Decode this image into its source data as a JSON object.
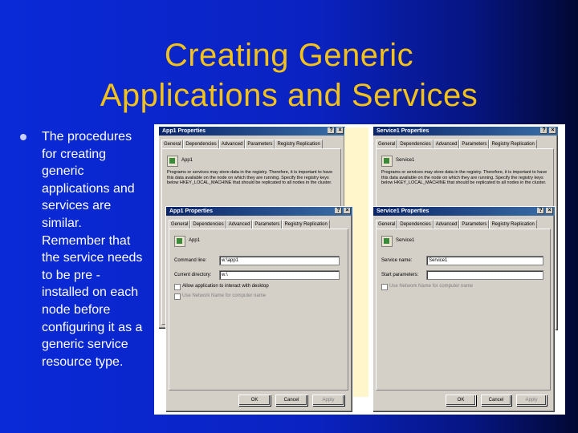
{
  "slide": {
    "title_line1": "Creating Generic",
    "title_line2": "Applications and Services",
    "bullet": "The procedures for creating generic applications and services are similar. Remember that the service needs to be pre -installed on each node before configuring it as a generic service resource type."
  },
  "app_back": {
    "title": "App1 Properties",
    "help": "?",
    "close": "×",
    "tabs": [
      "General",
      "Dependencies",
      "Advanced",
      "Parameters",
      "Registry Replication"
    ],
    "name": "App1",
    "desc": "Programs or services may store data in the registry. Therefore, it is important to have this data available on the node on which they are running. Specify the registry keys below HKEY_LOCAL_MACHINE that should be replicated to all nodes in the cluster."
  },
  "app_front": {
    "title": "App1 Properties",
    "help": "?",
    "close": "×",
    "tabs": [
      "General",
      "Dependencies",
      "Advanced",
      "Parameters",
      "Registry Replication"
    ],
    "name": "App1",
    "command_line_label": "Command line:",
    "command_line_value": "w:\\app1",
    "current_dir_label": "Current directory:",
    "current_dir_value": "w:\\",
    "allow_interact": "Allow application to interact with desktop",
    "use_network_name": "Use Network Name for computer name",
    "ok": "OK",
    "cancel": "Cancel",
    "apply": "Apply"
  },
  "svc_back": {
    "title": "Service1 Properties",
    "help": "?",
    "close": "×",
    "tabs": [
      "General",
      "Dependencies",
      "Advanced",
      "Parameters",
      "Registry Replication"
    ],
    "name": "Service1",
    "desc": "Programs or services may store data in the registry. Therefore, it is important to have this data available on the node on which they are running. Specify the registry keys below HKEY_LOCAL_MACHINE that should be replicated to all nodes in the cluster."
  },
  "svc_front": {
    "title": "Service1 Properties",
    "help": "?",
    "close": "×",
    "tabs": [
      "General",
      "Dependencies",
      "Advanced",
      "Parameters",
      "Registry Replication"
    ],
    "name": "Service1",
    "service_name_label": "Service name:",
    "service_name_value": "Service1",
    "start_params_label": "Start parameters:",
    "start_params_value": "",
    "use_network_name": "Use Network Name for computer name",
    "ok": "OK",
    "cancel": "Cancel",
    "apply": "Apply"
  },
  "colors": {
    "title": "#f2c21b",
    "background": "#0a2ad8",
    "titlebar": "#0a246a"
  }
}
